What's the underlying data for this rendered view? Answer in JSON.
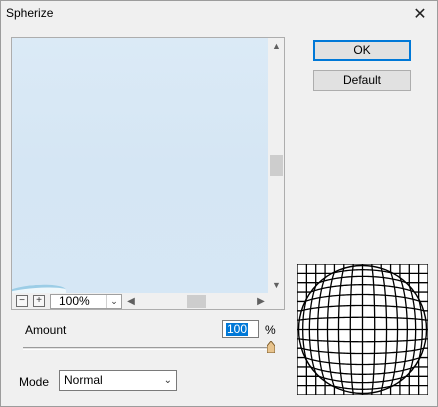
{
  "window": {
    "title": "Spherize",
    "close_symbol": "✕"
  },
  "preview": {
    "zoom_level": "100%",
    "zoom_out_symbol": "−",
    "zoom_in_symbol": "+"
  },
  "buttons": {
    "ok_label": "OK",
    "default_label": "Default"
  },
  "amount": {
    "label": "Amount",
    "value": "100",
    "unit": "%",
    "slider_level_percent": 100
  },
  "mode": {
    "label": "Mode",
    "selected": "Normal"
  },
  "icons": {
    "close": "close-icon",
    "zoom_out": "minus-icon",
    "zoom_in": "plus-icon",
    "scroll_up": "triangle-up-icon",
    "scroll_down": "triangle-down-icon",
    "scroll_left": "triangle-left-icon",
    "scroll_right": "triangle-right-icon",
    "dropdown": "chevron-down-icon"
  },
  "colors": {
    "accent": "#0078d7",
    "preview_bg": "#d6e7f5"
  }
}
